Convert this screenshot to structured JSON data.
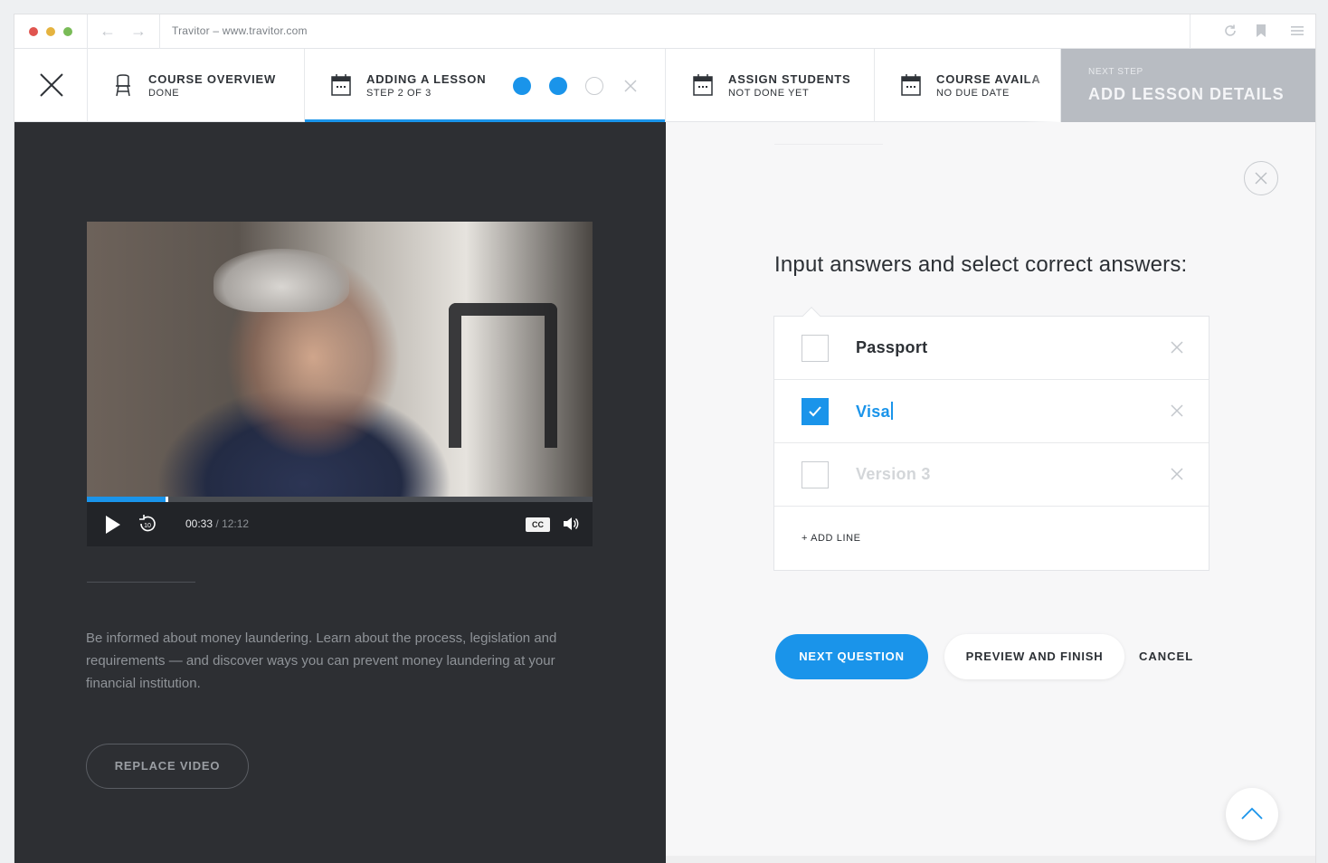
{
  "browser": {
    "address": "Travitor – www.travitor.com"
  },
  "steps": {
    "course_overview": {
      "title": "COURSE OVERVIEW",
      "status": "DONE"
    },
    "adding_lesson": {
      "title": "ADDING A LESSON",
      "status": "STEP 2 OF 3",
      "progress_done": 2,
      "progress_total": 3
    },
    "assign_students": {
      "title": "ASSIGN STUDENTS",
      "status": "NOT DONE YET"
    },
    "course_availability": {
      "title": "COURSE AVAILA",
      "status": "NO DUE DATE"
    },
    "next_step": {
      "label": "NEXT STEP",
      "title": "ADD LESSON DETAILS"
    }
  },
  "video": {
    "current_time": "00:33",
    "separator": "/",
    "duration": "12:12",
    "progress_fraction": 0.155,
    "cc_label": "CC",
    "rewind_label": "10"
  },
  "lesson": {
    "description": "Be informed about money laundering. Learn about the process, legislation and requirements — and discover ways you can prevent money laundering at your financial institution.",
    "replace_video_label": "REPLACE VIDEO"
  },
  "question": {
    "prompt": "Input answers and select correct answers:",
    "answers": [
      {
        "text": "Passport",
        "checked": false
      },
      {
        "text": "Visa",
        "checked": true
      },
      {
        "placeholder": "Version 3",
        "checked": false
      }
    ],
    "add_line_label": "+ ADD LINE"
  },
  "actions": {
    "next_question": "NEXT QUESTION",
    "preview_finish": "PREVIEW AND FINISH",
    "cancel": "CANCEL"
  },
  "colors": {
    "accent": "#1a94ea",
    "dark_panel": "#2d2f33",
    "next_step_bg": "#b8bcc2"
  }
}
